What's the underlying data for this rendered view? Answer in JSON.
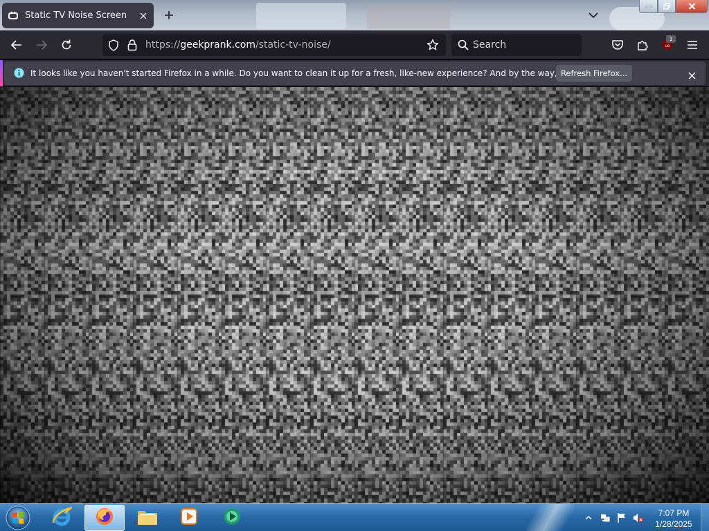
{
  "browser": {
    "tab": {
      "title": "Static TV Noise Screen"
    },
    "url": {
      "domain": "geekprank.com",
      "prefix": "https://",
      "path": "/static-tv-noise/"
    },
    "search": {
      "placeholder": "Search"
    },
    "extension_badge": "1"
  },
  "notification": {
    "message": "It looks like you haven't started Firefox in a while. Do you want to clean it up for a fresh, like-new experience? And by the way, welcome back!",
    "button_label": "Refresh Firefox..."
  },
  "page": {
    "content": "static-tv-noise"
  },
  "taskbar": {
    "apps": [
      {
        "name": "internet-explorer",
        "icon": "ie-icon"
      },
      {
        "name": "firefox",
        "icon": "firefox-icon",
        "active": true
      },
      {
        "name": "file-explorer",
        "icon": "folder-icon"
      },
      {
        "name": "media-player",
        "icon": "media-player-icon"
      },
      {
        "name": "app",
        "icon": "green-app-icon"
      }
    ],
    "clock": {
      "time": "7:07 PM",
      "date": "1/28/2025"
    }
  },
  "colors": {
    "toolbar": "#2b2a33",
    "urlbar": "#1c1b22",
    "notification": "#42414d",
    "taskbar": "#2a6aa8"
  }
}
